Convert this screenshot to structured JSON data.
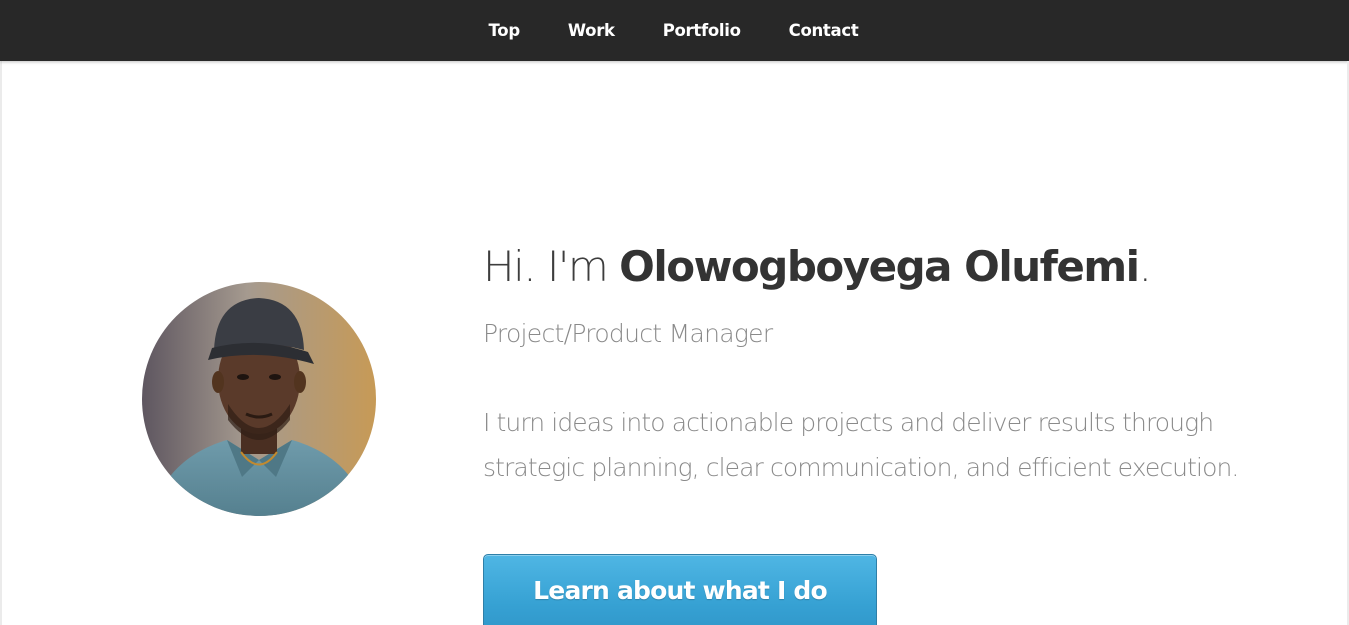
{
  "nav": {
    "items": [
      {
        "label": "Top"
      },
      {
        "label": "Work"
      },
      {
        "label": "Portfolio"
      },
      {
        "label": "Contact"
      }
    ]
  },
  "hero": {
    "greeting_prefix": "Hi. I'm ",
    "name": "Olowogboyega Olufemi",
    "greeting_suffix": ".",
    "role": "Project/Product Manager",
    "description": "I turn ideas into actionable projects and deliver results through\nstrategic planning, clear communication, and efficient execution.",
    "cta_label": "Learn about what I do"
  },
  "colors": {
    "nav_background": "#282828",
    "cta_accent": "#3aa5d7",
    "heading_text": "#333333",
    "body_text": "#8a8a8a"
  },
  "icons": {
    "avatar": "profile-photo"
  }
}
